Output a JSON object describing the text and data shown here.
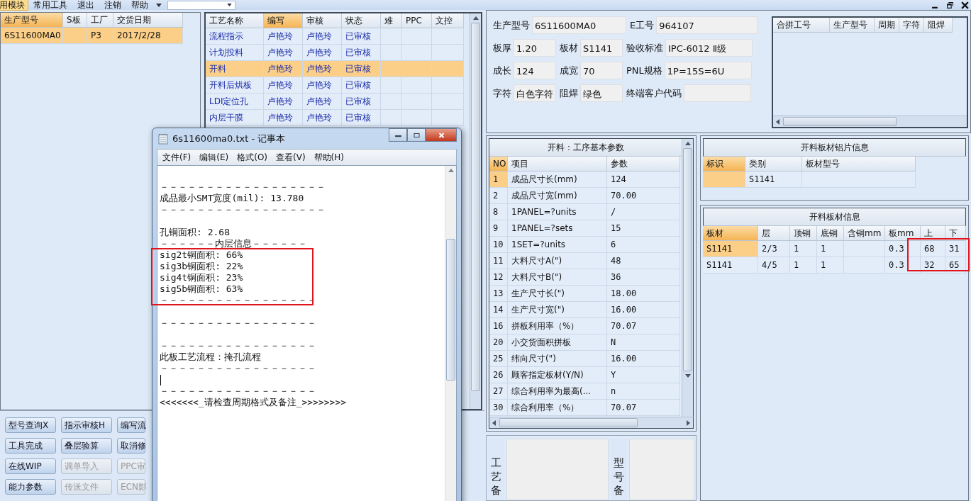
{
  "menu_bar": {
    "items": [
      {
        "label": "用模块",
        "selected": true
      },
      {
        "label": "常用工具",
        "selected": false
      },
      {
        "label": "退出",
        "selected": false
      },
      {
        "label": "注销",
        "selected": false
      },
      {
        "label": "帮助",
        "selected": false
      }
    ]
  },
  "orders_table": {
    "columns": [
      {
        "label": "生产型号",
        "sorted": true
      },
      {
        "label": "S板",
        "sorted": false
      },
      {
        "label": "工厂",
        "sorted": false
      },
      {
        "label": "交货日期",
        "sorted": false
      }
    ],
    "rows": [
      {
        "model": "6S11600MA0",
        "factory": "P3",
        "date": "2017/2/28",
        "selected": true
      }
    ]
  },
  "process_table": {
    "columns": [
      {
        "label": "工艺名称",
        "sorted": false
      },
      {
        "label": "编写",
        "sorted": true
      },
      {
        "label": "审核",
        "sorted": false
      },
      {
        "label": "状态",
        "sorted": false
      },
      {
        "label": "难",
        "sorted": false
      },
      {
        "label": "PPC",
        "sorted": false
      },
      {
        "label": "文控",
        "sorted": false
      }
    ],
    "rows": [
      {
        "name": "流程指示",
        "writer": "卢艳玲",
        "reviewer": "卢艳玲",
        "status": "已审核",
        "selected": false
      },
      {
        "name": "计划投料",
        "writer": "卢艳玲",
        "reviewer": "卢艳玲",
        "status": "已审核",
        "selected": false
      },
      {
        "name": "开料",
        "writer": "卢艳玲",
        "reviewer": "卢艳玲",
        "status": "已审核",
        "selected": true
      },
      {
        "name": "开料后烘板",
        "writer": "卢艳玲",
        "reviewer": "卢艳玲",
        "status": "已审核",
        "selected": false
      },
      {
        "name": "LDI定位孔",
        "writer": "卢艳玲",
        "reviewer": "卢艳玲",
        "status": "已审核",
        "selected": false
      },
      {
        "name": "内层干膜",
        "writer": "卢艳玲",
        "reviewer": "卢艳玲",
        "status": "已审核",
        "selected": false
      }
    ]
  },
  "buttons": [
    {
      "label": "型号查询X",
      "disabled": false
    },
    {
      "label": "指示审核H",
      "disabled": false
    },
    {
      "label": "编写流",
      "disabled": false
    },
    {
      "label": "工具完成",
      "disabled": false
    },
    {
      "label": "叠层验算",
      "disabled": false
    },
    {
      "label": "取消修",
      "disabled": false
    },
    {
      "label": "在线WIP",
      "disabled": false
    },
    {
      "label": "调单导入",
      "disabled": true
    },
    {
      "label": "PPC审",
      "disabled": true
    },
    {
      "label": "能力参数",
      "disabled": false
    },
    {
      "label": "传送文件",
      "disabled": true
    },
    {
      "label": "ECN影",
      "disabled": true
    }
  ],
  "info_panel": {
    "fields": [
      {
        "label": "生产型号",
        "value": "6S11600MA0"
      },
      {
        "label": "E工号",
        "value": "964107"
      },
      {
        "label": "板厚",
        "value": "1.20"
      },
      {
        "label": "板材",
        "value": "S1141"
      },
      {
        "label": "验收标准",
        "value": "IPC-6012 Ⅱ级"
      },
      {
        "label": "成长",
        "value": "124"
      },
      {
        "label": "成宽",
        "value": "70"
      },
      {
        "label": "PNL规格",
        "value": "1P=15S=6U"
      },
      {
        "label": "字符",
        "value": "白色字符"
      },
      {
        "label": "阻焊",
        "value": "绿色"
      },
      {
        "label": "终端客户代码"
      }
    ]
  },
  "merge_table": {
    "columns": [
      {
        "label": "合拼工号",
        "sorted": false
      },
      {
        "label": "生产型号",
        "sorted": false
      },
      {
        "label": "周期",
        "sorted": false
      },
      {
        "label": "字符",
        "sorted": false
      },
      {
        "label": "阻焊",
        "sorted": false
      }
    ]
  },
  "params_table": {
    "title": "开料：工序基本参数",
    "columns": [
      {
        "label": "NO",
        "sorted": true
      },
      {
        "label": "项目",
        "sorted": false
      },
      {
        "label": "参数",
        "sorted": false
      }
    ],
    "rows": [
      {
        "no": "1",
        "item": "成品尺寸长(mm)",
        "value": "124",
        "current": true
      },
      {
        "no": "2",
        "item": "成品尺寸宽(mm)",
        "value": "70.00",
        "current": false
      },
      {
        "no": "8",
        "item": "1PANEL=?units",
        "value": "/",
        "current": false
      },
      {
        "no": "9",
        "item": "1PANEL=?sets",
        "value": "15",
        "current": false
      },
      {
        "no": "10",
        "item": "1SET=?units",
        "value": "6",
        "current": false
      },
      {
        "no": "11",
        "item": "大料尺寸A(\")",
        "value": "48",
        "current": false
      },
      {
        "no": "12",
        "item": "大料尺寸B(\")",
        "value": "36",
        "current": false
      },
      {
        "no": "13",
        "item": "生产尺寸长(\")",
        "value": "18.00",
        "current": false
      },
      {
        "no": "14",
        "item": "生产尺寸宽(\")",
        "value": "16.00",
        "current": false
      },
      {
        "no": "16",
        "item": "拼板利用率（%）",
        "value": "70.07",
        "current": false
      },
      {
        "no": "20",
        "item": "小交货面积拼板",
        "value": "N",
        "current": false
      },
      {
        "no": "25",
        "item": "纬向尺寸(\")",
        "value": "16.00",
        "current": false
      },
      {
        "no": "26",
        "item": "顾客指定板材(Y/N)",
        "value": "Y",
        "current": false
      },
      {
        "no": "27",
        "item": "综合利用率为最高(...",
        "value": "n",
        "current": false
      },
      {
        "no": "30",
        "item": "综合利用率（%）",
        "value": "70.07",
        "current": false
      }
    ]
  },
  "remarks": [
    {
      "label": "工艺备"
    },
    {
      "label": "型号备"
    }
  ],
  "foil_table": {
    "title": "开料板材铝片信息",
    "columns": [
      {
        "label": "标识",
        "sorted": true
      },
      {
        "label": "类别",
        "sorted": false
      },
      {
        "label": "板材型号",
        "sorted": false
      }
    ],
    "rows": [
      {
        "type": "S1141",
        "current": true
      }
    ]
  },
  "sheet_table": {
    "title": "开料板材信息",
    "columns": [
      {
        "label": "板材",
        "sorted": true
      },
      {
        "label": "层",
        "sorted": false
      },
      {
        "label": "顶铜",
        "sorted": false
      },
      {
        "label": "底铜",
        "sorted": false
      },
      {
        "label": "含铜mm",
        "sorted": false
      },
      {
        "label": "板mm",
        "sorted": false
      },
      {
        "label": "上",
        "sorted": false
      },
      {
        "label": "下",
        "sorted": false
      }
    ],
    "rows": [
      {
        "material": "S1141",
        "layer": "2/3",
        "top_copper": "1",
        "bottom_copper": "1",
        "thickness": "0.3",
        "upper": "68",
        "lower": "31",
        "current": true
      },
      {
        "material": "S1141",
        "layer": "4/5",
        "top_copper": "1",
        "bottom_copper": "1",
        "thickness": "0.3",
        "upper": "32",
        "lower": "65",
        "current": false
      }
    ]
  },
  "notepad": {
    "title": "6s11600ma0.txt - 记事本",
    "menu": [
      "文件(F)",
      "编辑(E)",
      "格式(O)",
      "查看(V)",
      "帮助(H)"
    ],
    "lines": [
      {
        "kind": "blank"
      },
      {
        "kind": "text",
        "text": "－－－－－－－－－－－－－－－－－－"
      },
      {
        "kind": "text",
        "text": "成品最小SMT宽度(mil): 13.780"
      },
      {
        "kind": "text",
        "text": "－－－－－－－－－－－－－－－－－－"
      },
      {
        "kind": "blank"
      },
      {
        "kind": "text",
        "text": "孔铜面积: 2.68"
      },
      {
        "kind": "text",
        "text": "－－－－－－内层信息－－－－－－"
      },
      {
        "kind": "text",
        "text": "sig2t铜面积: 66%"
      },
      {
        "kind": "text",
        "text": "sig3b铜面积: 22%"
      },
      {
        "kind": "text",
        "text": "sig4t铜面积: 23%"
      },
      {
        "kind": "text",
        "text": "sig5b铜面积: 63%"
      },
      {
        "kind": "text",
        "text": "－－－－－－－－－－－－－－－－－"
      },
      {
        "kind": "blank"
      },
      {
        "kind": "text",
        "text": "－－－－－－－－－－－－－－－－－"
      },
      {
        "kind": "blank"
      },
      {
        "kind": "text",
        "text": "－－－－－－－－－－－－－－－－－"
      },
      {
        "kind": "text",
        "text": "此板工艺流程：掩孔流程"
      },
      {
        "kind": "text",
        "text": "－－－－－－－－－－－－－－－－－"
      },
      {
        "kind": "cursor"
      },
      {
        "kind": "text",
        "text": "－－－－－－－－－－－－－－－－－"
      },
      {
        "kind": "text",
        "text": "<<<<<<<_请检查周期格式及备注_>>>>>>>>"
      }
    ]
  }
}
